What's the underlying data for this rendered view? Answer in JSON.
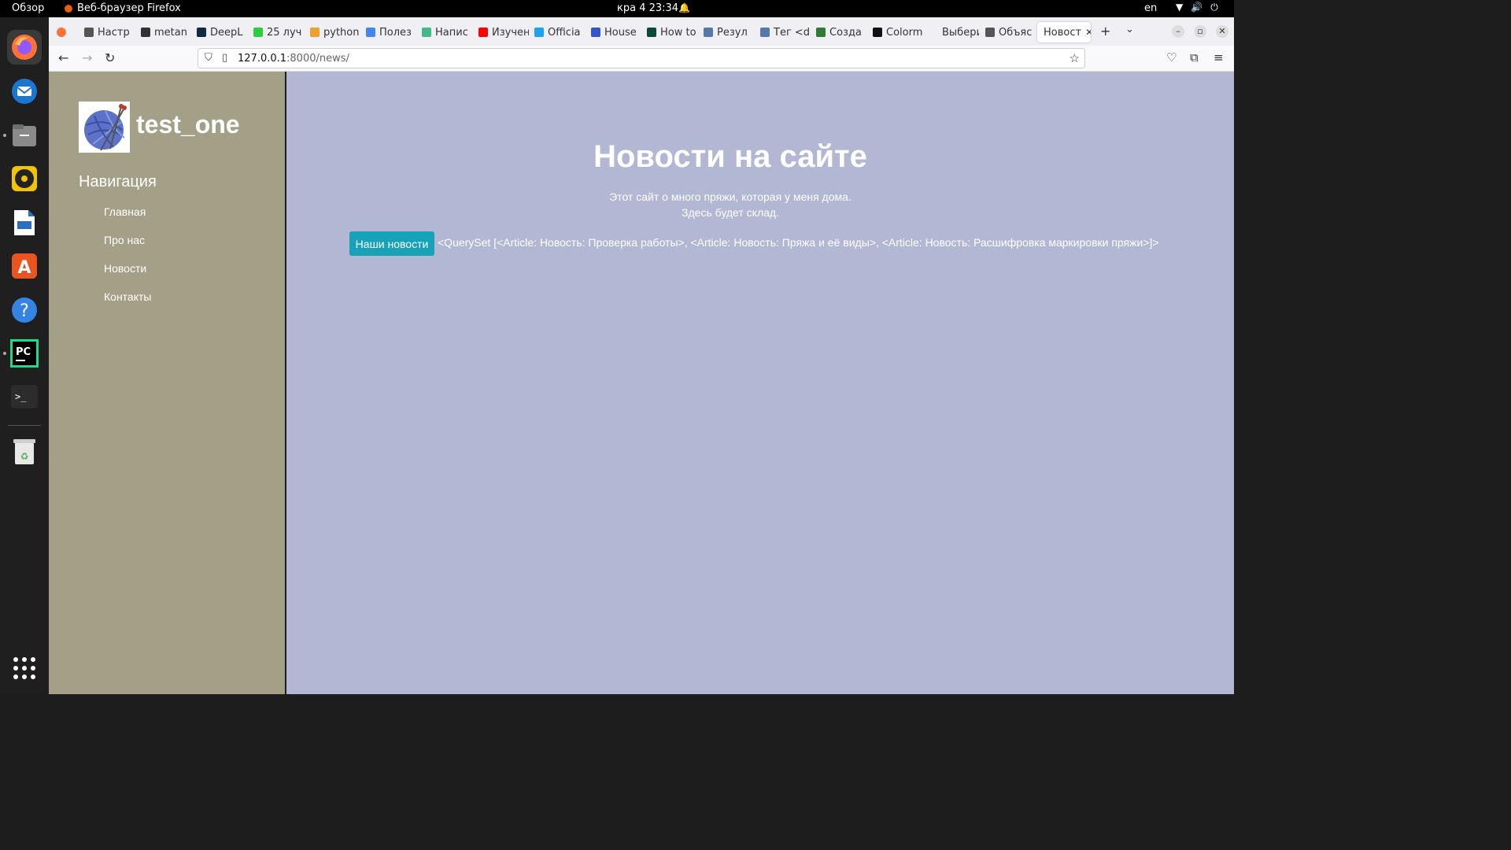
{
  "topbar": {
    "overview": "Обзор",
    "app_name": "Веб-браузер Firefox",
    "clock": "кра 4  23:34",
    "lang": "en"
  },
  "dock": {
    "items": [
      "firefox-icon",
      "thunderbird-icon",
      "files-icon",
      "rhythmbox-icon",
      "writer-icon",
      "app-center-icon",
      "help-icon",
      "pycharm-icon",
      "terminal-icon",
      "trash-icon"
    ]
  },
  "browser": {
    "tabs": [
      {
        "label": "Настр",
        "color": "#555555"
      },
      {
        "label": "metan",
        "color": "#333333"
      },
      {
        "label": "DeepL",
        "color": "#0f2b46"
      },
      {
        "label": "25 луч",
        "color": "#2ecc40"
      },
      {
        "label": "python",
        "color": "#f0a030"
      },
      {
        "label": "Полез",
        "color": "#4285f4"
      },
      {
        "label": "Напис",
        "color": "#44b78b"
      },
      {
        "label": "Изучен",
        "color": "#ff0000"
      },
      {
        "label": "Officia",
        "color": "#1da1f2"
      },
      {
        "label": "House",
        "color": "#3355cc"
      },
      {
        "label": "How to",
        "color": "#0c4b33"
      },
      {
        "label": "Резул",
        "color": "#5577aa"
      },
      {
        "label": "Тег <di",
        "color": "#5577aa"
      },
      {
        "label": "Созда",
        "color": "#2e7d32"
      },
      {
        "label": "Colorm",
        "color": "#111111"
      },
      {
        "label": "Выберит",
        "color": "#f0f0f4"
      },
      {
        "label": "Объяс",
        "color": "#555555"
      }
    ],
    "active_tab": "Новост",
    "url_host": "127.0.0.1",
    "url_path": ":8000/news/"
  },
  "site": {
    "title": "test_one",
    "nav_title": "Навигация",
    "nav_items": [
      "Главная",
      "Про нас",
      "Новости",
      "Контакты"
    ],
    "heading": "Новости на сайте",
    "desc_line1": "Этот сайт о много пряжи, которая у меня дома.",
    "desc_line2": "Здесь будет склад.",
    "button_label": "Наши новости",
    "queryset_text": "<QuerySet [<Article: Новость: Проверка работы>, <Article: Новость: Пряжа и её виды>, <Article: Новость: Расшифровка маркировки пряжи>]>"
  },
  "colors": {
    "sidebar_bg": "#a4a087",
    "main_bg": "#b2b7d3",
    "button_bg": "#17a2b8"
  }
}
